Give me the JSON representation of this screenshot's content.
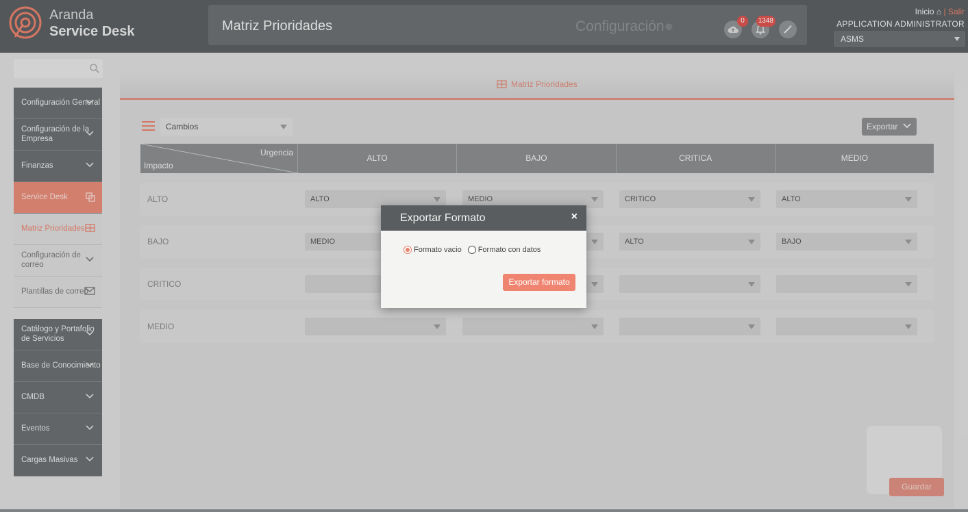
{
  "brand": {
    "line1": "Aranda",
    "line2": "Service Desk"
  },
  "header": {
    "page_title": "Matriz Prioridades",
    "config_label": "Configuración",
    "upload_count": "0",
    "notifications_count": "1348"
  },
  "user": {
    "home_label": "Inicio",
    "separator": "|",
    "logout_label": "Salir",
    "role": "APPLICATION ADMINISTRATOR",
    "project": "ASMS"
  },
  "sidebar": {
    "search_placeholder": "",
    "items": [
      {
        "label": "Configuración General"
      },
      {
        "label": "Configuración de la Empresa"
      },
      {
        "label": "Finanzas"
      },
      {
        "label": "Service Desk"
      },
      {
        "label": "Matriz Prioridades"
      },
      {
        "label": "Configuración de correo"
      },
      {
        "label": "Plantillas de correo"
      },
      {
        "label": "Catálogo y Portafolio de Servicios"
      },
      {
        "label": "Base de Conocimiento"
      },
      {
        "label": "CMDB"
      },
      {
        "label": "Eventos"
      },
      {
        "label": "Cargas Masivas"
      }
    ]
  },
  "main": {
    "tab_label": "Matriz Prioridades",
    "type_selected": "Cambios",
    "export_label": "Exportar",
    "save_label": "Guardar",
    "matrix": {
      "urgency_label": "Urgencia",
      "impact_label": "Impacto",
      "columns": [
        "ALTO",
        "BAJO",
        "CRITICA",
        "MEDIO"
      ],
      "rows": [
        {
          "label": "ALTO",
          "cells": [
            "ALTO",
            "MEDIO",
            "CRITICO",
            "ALTO"
          ]
        },
        {
          "label": "BAJO",
          "cells": [
            "MEDIO",
            "",
            "ALTO",
            "BAJO"
          ]
        },
        {
          "label": "CRITICO",
          "cells": [
            "",
            "",
            "",
            ""
          ]
        },
        {
          "label": "MEDIO",
          "cells": [
            "",
            "",
            "",
            ""
          ]
        }
      ]
    }
  },
  "modal": {
    "title": "Exportar Formato",
    "close_label": "×",
    "option_empty": "Formato vacio",
    "option_data": "Formato con datos",
    "selected_option": "Formato vacio",
    "submit_label": "Exportar formato"
  },
  "colors": {
    "accent": "#e8806b",
    "header_bg": "#5b5f61",
    "sidebar_bg": "#6a6e70",
    "modal_header": "#5a5d5f"
  }
}
